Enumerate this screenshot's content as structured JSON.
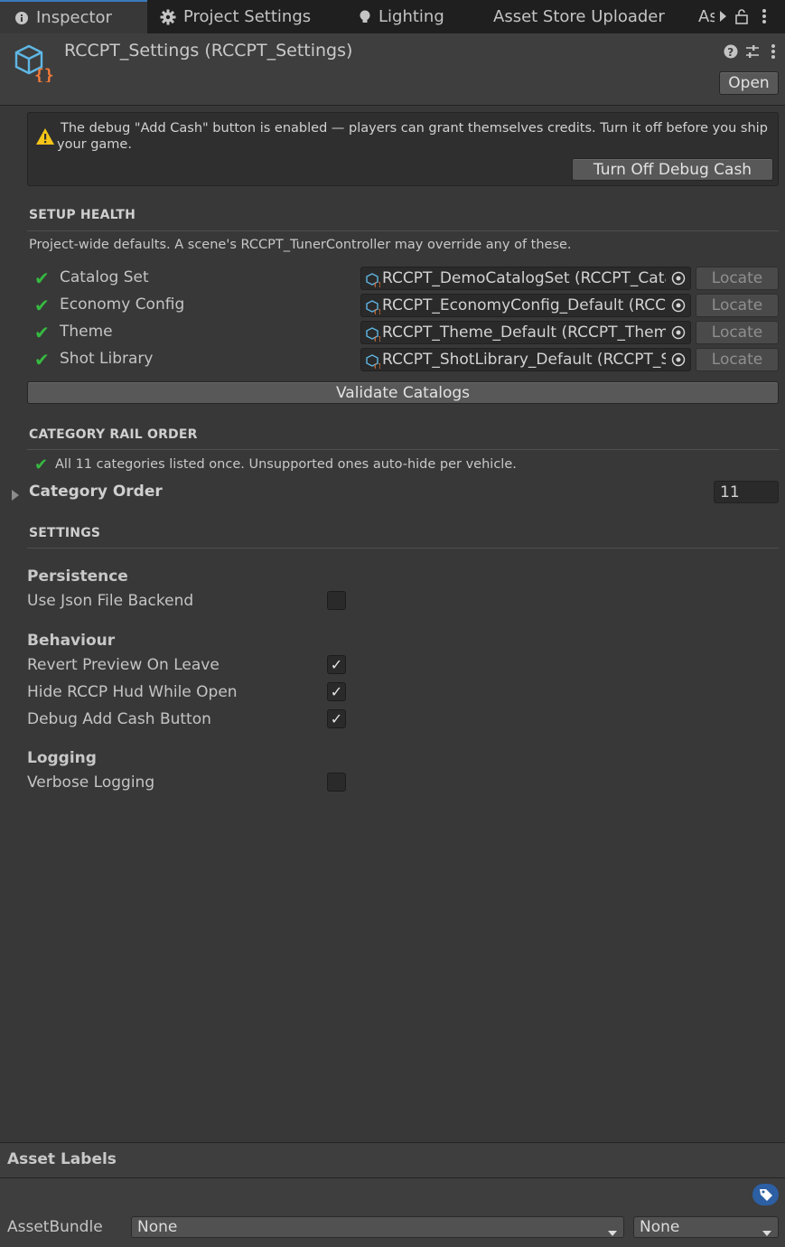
{
  "tabs": [
    {
      "label": "Inspector",
      "icon": "info-icon"
    },
    {
      "label": "Project Settings",
      "icon": "gear-icon"
    },
    {
      "label": "Lighting",
      "icon": "lightbulb-icon"
    },
    {
      "label": "Asset Store Uploader"
    },
    {
      "label": "As"
    }
  ],
  "header": {
    "title": "RCCPT_Settings (RCCPT_Settings)",
    "open_label": "Open"
  },
  "warning": {
    "text": "The debug \"Add Cash\" button is enabled — players can grant themselves credits. Turn it off before you ship your game.",
    "button_label": "Turn Off Debug Cash"
  },
  "setup_health": {
    "title": "SETUP HEALTH",
    "description": "Project-wide defaults. A scene's RCCPT_TunerController may override any of these.",
    "rows": [
      {
        "label": "Catalog Set",
        "value": "RCCPT_DemoCatalogSet (RCCPT_CatalogSet)",
        "locate": "Locate"
      },
      {
        "label": "Economy Config",
        "value": "RCCPT_EconomyConfig_Default (RCCPT_EconomyConfig)",
        "locate": "Locate"
      },
      {
        "label": "Theme",
        "value": "RCCPT_Theme_Default (RCCPT_Theme)",
        "locate": "Locate"
      },
      {
        "label": "Shot Library",
        "value": "RCCPT_ShotLibrary_Default (RCCPT_ShotLibrary)",
        "locate": "Locate"
      }
    ],
    "validate_label": "Validate Catalogs"
  },
  "category_rail": {
    "title": "CATEGORY RAIL ORDER",
    "status": "All 11 categories listed once. Unsupported ones auto-hide per vehicle.",
    "order_label": "Category Order",
    "order_count": "11"
  },
  "settings": {
    "title": "SETTINGS",
    "groups": [
      {
        "title": "Persistence",
        "items": [
          {
            "label": "Use Json File Backend",
            "checked": false
          }
        ]
      },
      {
        "title": "Behaviour",
        "items": [
          {
            "label": "Revert Preview On Leave",
            "checked": true
          },
          {
            "label": "Hide RCCP Hud While Open",
            "checked": true
          },
          {
            "label": "Debug Add Cash Button",
            "checked": true
          }
        ]
      },
      {
        "title": "Logging",
        "items": [
          {
            "label": "Verbose Logging",
            "checked": false
          }
        ]
      }
    ]
  },
  "footer": {
    "asset_labels": "Asset Labels",
    "assetbundle_label": "AssetBundle",
    "bundle_value": "None",
    "variant_value": "None"
  },
  "colors": {
    "accent": "#3a79bb",
    "success": "#36b940",
    "warning": "#f5c518",
    "label_badge": "#2c5fa3"
  }
}
